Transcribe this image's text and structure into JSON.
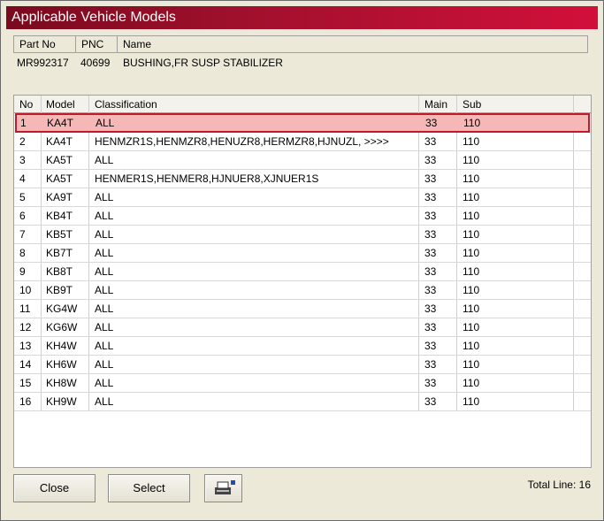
{
  "window": {
    "title": "Applicable Vehicle Models"
  },
  "part_info": {
    "headers": {
      "part_no": "Part No",
      "pnc": "PNC",
      "name": "Name"
    },
    "part_no": "MR992317",
    "pnc": "40699",
    "name": "BUSHING,FR SUSP STABILIZER"
  },
  "table": {
    "headers": {
      "no": "No",
      "model": "Model",
      "classification": "Classification",
      "main": "Main",
      "sub": "Sub"
    },
    "rows": [
      {
        "no": "1",
        "model": "KA4T",
        "classification": "ALL",
        "main": "33",
        "sub": "110"
      },
      {
        "no": "2",
        "model": "KA4T",
        "classification": "HENMZR1S,HENMZR8,HENUZR8,HERMZR8,HJNUZL,  >>>>",
        "main": "33",
        "sub": "110"
      },
      {
        "no": "3",
        "model": "KA5T",
        "classification": "ALL",
        "main": "33",
        "sub": "110"
      },
      {
        "no": "4",
        "model": "KA5T",
        "classification": "HENMER1S,HENMER8,HJNUER8,XJNUER1S",
        "main": "33",
        "sub": "110"
      },
      {
        "no": "5",
        "model": "KA9T",
        "classification": "ALL",
        "main": "33",
        "sub": "110"
      },
      {
        "no": "6",
        "model": "KB4T",
        "classification": "ALL",
        "main": "33",
        "sub": "110"
      },
      {
        "no": "7",
        "model": "KB5T",
        "classification": "ALL",
        "main": "33",
        "sub": "110"
      },
      {
        "no": "8",
        "model": "KB7T",
        "classification": "ALL",
        "main": "33",
        "sub": "110"
      },
      {
        "no": "9",
        "model": "KB8T",
        "classification": "ALL",
        "main": "33",
        "sub": "110"
      },
      {
        "no": "10",
        "model": "KB9T",
        "classification": "ALL",
        "main": "33",
        "sub": "110"
      },
      {
        "no": "11",
        "model": "KG4W",
        "classification": "ALL",
        "main": "33",
        "sub": "110"
      },
      {
        "no": "12",
        "model": "KG6W",
        "classification": "ALL",
        "main": "33",
        "sub": "110"
      },
      {
        "no": "13",
        "model": "KH4W",
        "classification": "ALL",
        "main": "33",
        "sub": "110"
      },
      {
        "no": "14",
        "model": "KH6W",
        "classification": "ALL",
        "main": "33",
        "sub": "110"
      },
      {
        "no": "15",
        "model": "KH8W",
        "classification": "ALL",
        "main": "33",
        "sub": "110"
      },
      {
        "no": "16",
        "model": "KH9W",
        "classification": "ALL",
        "main": "33",
        "sub": "110"
      }
    ]
  },
  "buttons": {
    "close": "Close",
    "select": "Select",
    "print_icon": "printer-icon"
  },
  "footer": {
    "total_line": "Total Line: 16"
  },
  "colors": {
    "title_start": "#7a0a1e",
    "title_end": "#d2103a",
    "selected_row_bg": "#f6b7b7",
    "selected_row_border": "#c01a2a"
  }
}
